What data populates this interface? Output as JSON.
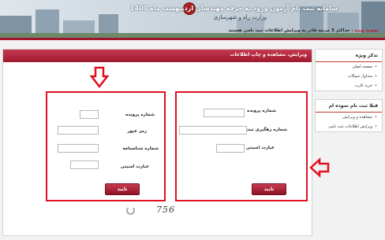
{
  "header": {
    "title": "سامانه ثبت نام آزمون ورود به حرفه مهندسان اردیبهشت ماه 1400",
    "subtitle": "وزارت راه و شهرسازی"
  },
  "main": {
    "panel_title": "ویرایش، مشاهده و چاپ اطلاعات",
    "note_label": "توصیه ویژه :",
    "note_text": "حداکثر 3 مرتبه قادر به ویرایش اطلاعات ثبت نامی هستید"
  },
  "right_form": {
    "fields": [
      {
        "label": "شماره پرونده",
        "value": ""
      },
      {
        "label": "شماره رهگیری ثبت نام",
        "value": ""
      },
      {
        "label": "عبارت امنیتی",
        "value": ""
      }
    ],
    "submit_label": "تایید"
  },
  "left_form": {
    "fields": [
      {
        "label": "شماره پرونده",
        "value": ""
      },
      {
        "label": "رمز عبور",
        "value": ""
      },
      {
        "label": "شماره شناسنامه",
        "value": ""
      },
      {
        "label": "عبارت امنیتی",
        "value": ""
      }
    ],
    "submit_label": "تایید"
  },
  "captcha": {
    "text": "756"
  },
  "sidebar": {
    "box1": {
      "title": "تذکر ویژه",
      "items": [
        "صفحه اصلی",
        "متداول سوالات",
        "خرید کارت"
      ]
    },
    "box2": {
      "title": "قبلا ثبت نام نموده ام",
      "items": [
        "مشاهده و ویرایش",
        "ویرایش اطلاعات ثبت نامی"
      ]
    }
  },
  "colors": {
    "brand": "#a0152b",
    "highlight": "#e01020"
  }
}
